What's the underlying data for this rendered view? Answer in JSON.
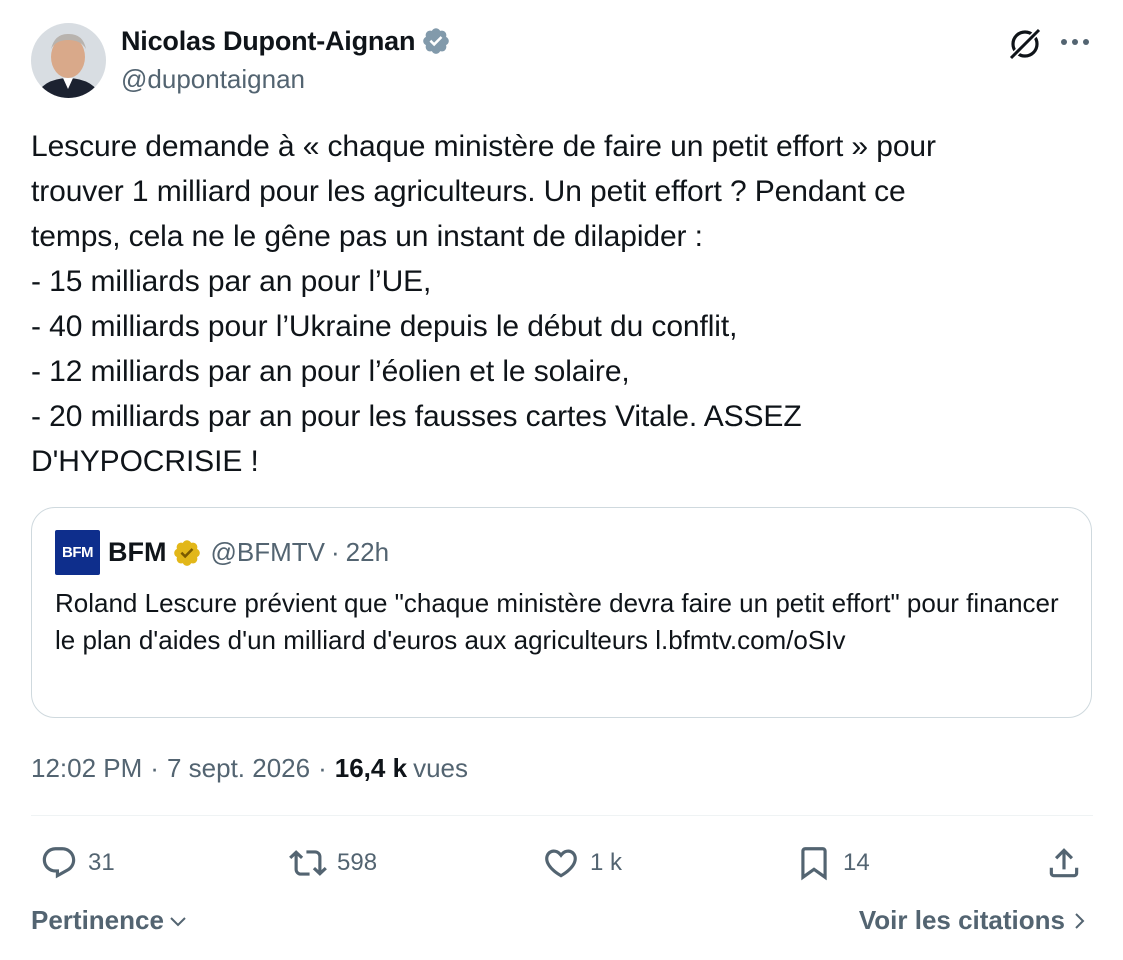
{
  "author": {
    "name": "Nicolas Dupont-Aignan",
    "handle": "@dupontaignan",
    "verified_color": "#829aab"
  },
  "tweet": {
    "text": "Lescure demande à « chaque ministère de faire un petit effort » pour\ntrouver 1 milliard pour les agriculteurs. Un petit effort ? Pendant ce\ntemps, cela ne le gêne pas un instant de dilapider :\n- 15 milliards par an pour l’UE,\n- 40 milliards pour l’Ukraine depuis le début du conflit,\n- 12 milliards par an pour l’éolien et le solaire,\n- 20 milliards par an pour les fausses cartes Vitale. ASSEZ\nD'HYPOCRISIE !"
  },
  "quote": {
    "logo_text": "BFM",
    "name": "BFM",
    "handle": "@BFMTV",
    "dot": "·",
    "time": "22h",
    "badge_color": "#e2b719",
    "text": "Roland Lescure prévient que \"chaque ministère devra faire un petit effort\" pour financer le plan d'aides d'un milliard d'euros aux agriculteurs l.bfmtv.com/oSIv"
  },
  "meta": {
    "time": "12:02 PM",
    "sep1": "·",
    "date": "7 sept. 2026",
    "sep2": "·",
    "views_count": "16,4 k",
    "views_label": "vues"
  },
  "actions": {
    "replies": "31",
    "reposts": "598",
    "likes": "1 k",
    "bookmarks": "14"
  },
  "footer": {
    "sort_label": "Pertinence",
    "quotes_label": "Voir les citations"
  },
  "colors": {
    "text_primary": "#0f1419",
    "text_secondary": "#536471",
    "border": "#cfd9de"
  }
}
